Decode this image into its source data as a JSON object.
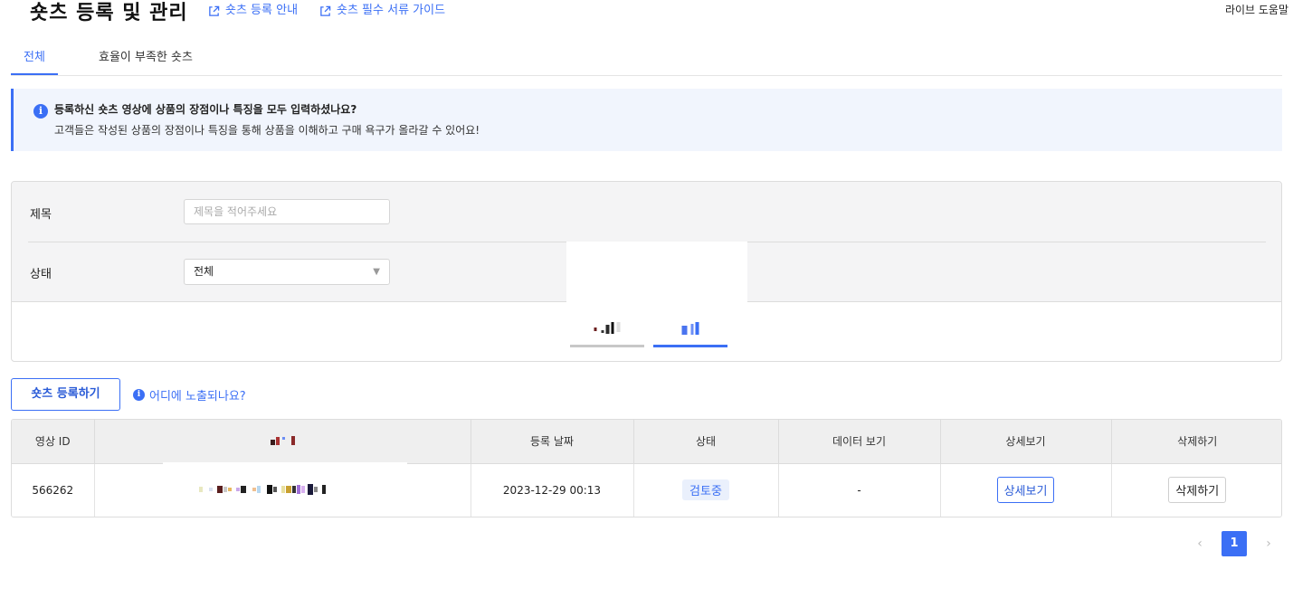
{
  "header": {
    "title": "숏츠 등록 및 관리",
    "links": [
      {
        "label": "숏츠 등록 안내",
        "icon": "external-link-icon"
      },
      {
        "label": "숏츠 필수 서류 가이드",
        "icon": "external-link-icon"
      }
    ],
    "live_help": "라이브 도움말"
  },
  "tabs": [
    {
      "label": "전체",
      "active": true
    },
    {
      "label": "효율이 부족한 숏츠",
      "active": false
    }
  ],
  "info": {
    "title": "등록하신 숏츠 영상에 상품의 장점이나 특징을 모두 입력하셨나요?",
    "description": "고객들은 작성된 상품의 장점이나 특징을 통해 상품을 이해하고 구매 욕구가 올라갈 수 있어요!"
  },
  "filters": {
    "title_label": "제목",
    "title_placeholder": "제목을 적어주세요",
    "status_label": "상태",
    "status_value": "전체"
  },
  "actions": {
    "register_button": "숏츠 등록하기",
    "where_link": "어디에 노출되나요?"
  },
  "table": {
    "columns": [
      "영상 ID",
      "",
      "등록 날짜",
      "상태",
      "데이터 보기",
      "상세보기",
      "삭제하기"
    ],
    "rows": [
      {
        "id": "566262",
        "date": "2023-12-29 00:13",
        "status": "검토중",
        "data_view": "-",
        "detail_button": "상세보기",
        "delete_button": "삭제하기"
      }
    ]
  },
  "pagination": {
    "current_page": "1",
    "prev_icon": "chevron-left-icon",
    "next_icon": "chevron-right-icon"
  },
  "colors": {
    "accent": "#3b6ff5",
    "info_bg": "#f1f5fd",
    "panel_bg": "#f4f4f5"
  }
}
